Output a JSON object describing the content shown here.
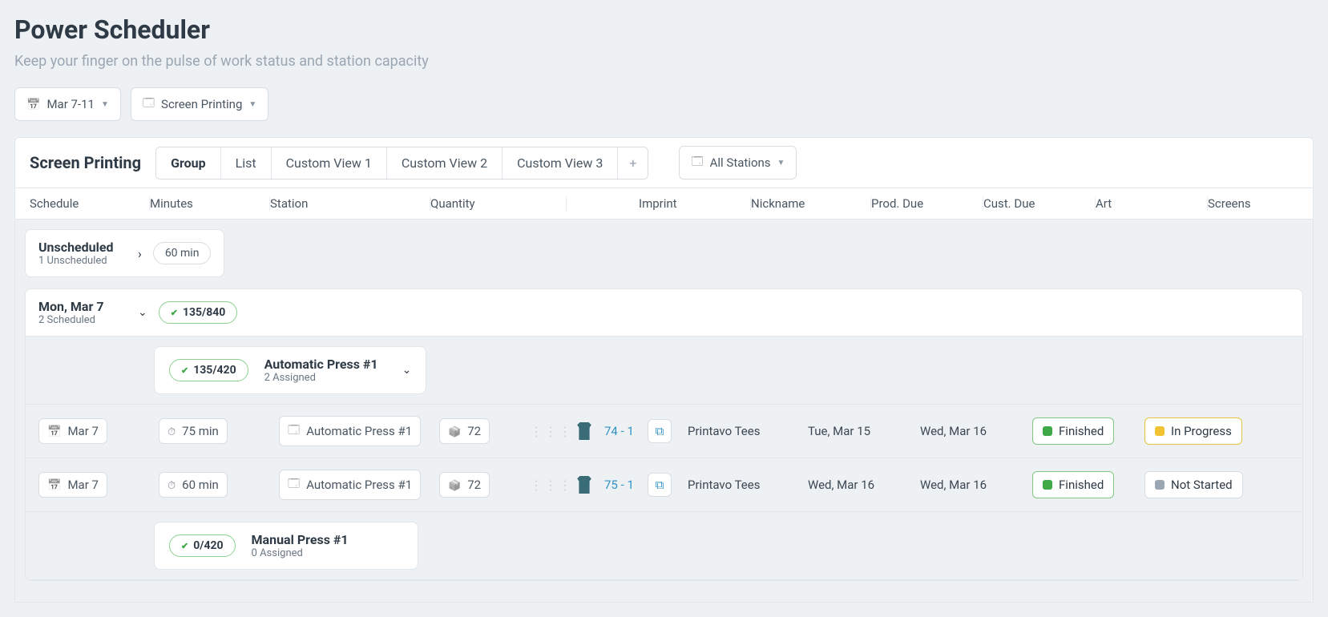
{
  "page": {
    "title": "Power Scheduler",
    "subtitle": "Keep your finger on the pulse of work status and station capacity"
  },
  "controls": {
    "date_range": "Mar 7-11",
    "print_type": "Screen Printing",
    "station_filter": "All Stations"
  },
  "panel": {
    "title": "Screen Printing",
    "tabs": [
      "Group",
      "List",
      "Custom View 1",
      "Custom View 2",
      "Custom View 3"
    ],
    "plus": "+"
  },
  "columns": [
    "Schedule",
    "Minutes",
    "Station",
    "Quantity",
    "Imprint",
    "Nickname",
    "Prod. Due",
    "Cust. Due",
    "Art",
    "Screens"
  ],
  "unscheduled": {
    "title": "Unscheduled",
    "sub": "1 Unscheduled",
    "minutes": "60 min"
  },
  "day": {
    "title": "Mon, Mar 7",
    "sub": "2 Scheduled",
    "capacity": "135/840",
    "stations": [
      {
        "capacity": "135/420",
        "name": "Automatic Press #1",
        "assigned": "2 Assigned",
        "expanded": true,
        "jobs": [
          {
            "date": "Mar 7",
            "minutes": "75 min",
            "station": "Automatic Press #1",
            "qty": "72",
            "imprint": "74 - 1",
            "nickname": "Printavo Tees",
            "prod_due": "Tue, Mar 15",
            "cust_due": "Wed, Mar 16",
            "art": "Finished",
            "screens": "In Progress"
          },
          {
            "date": "Mar 7",
            "minutes": "60 min",
            "station": "Automatic Press #1",
            "qty": "72",
            "imprint": "75 - 1",
            "nickname": "Printavo Tees",
            "prod_due": "Wed, Mar 16",
            "cust_due": "Wed, Mar 16",
            "art": "Finished",
            "screens": "Not Started"
          }
        ]
      },
      {
        "capacity": "0/420",
        "name": "Manual Press #1",
        "assigned": "0 Assigned",
        "expanded": false,
        "jobs": []
      }
    ]
  },
  "status_colors": {
    "Finished": "green",
    "In Progress": "yellow",
    "Not Started": "gray"
  }
}
